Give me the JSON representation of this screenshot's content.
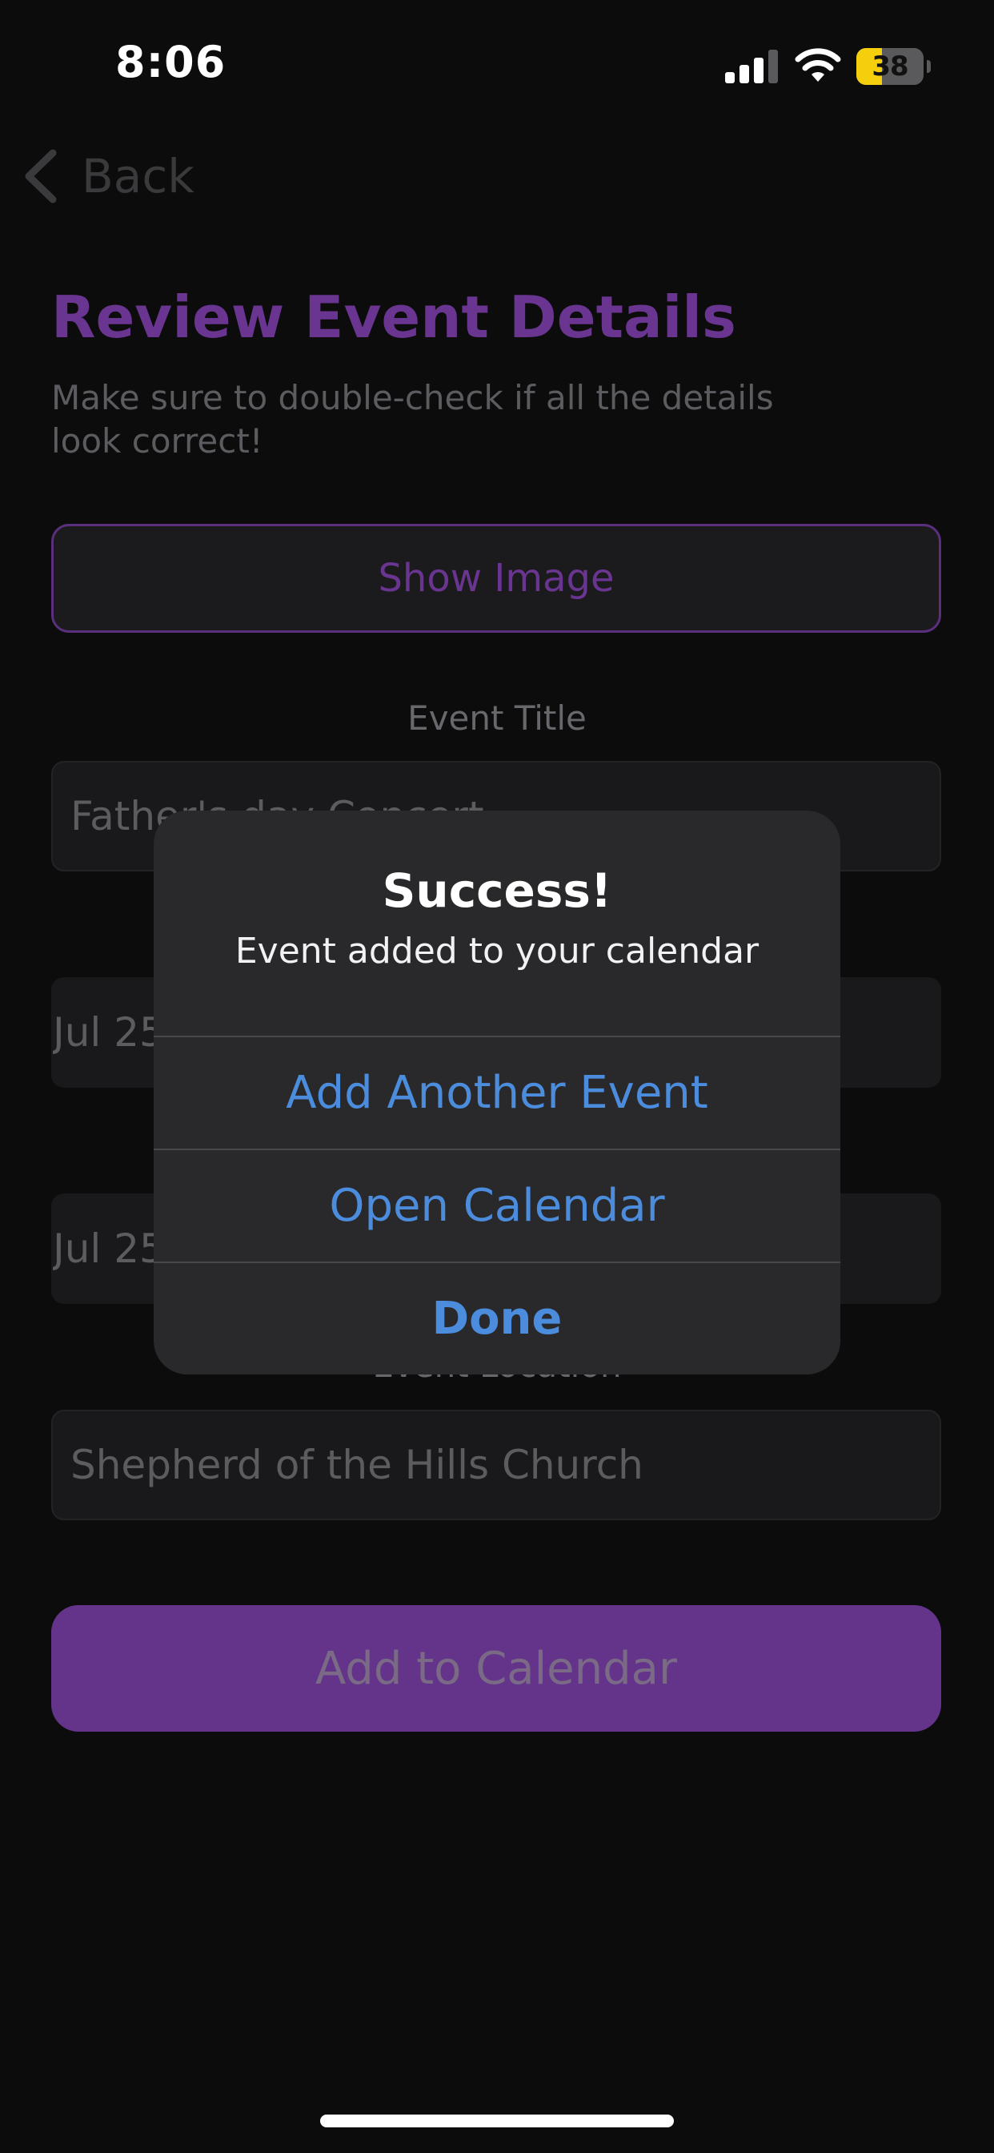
{
  "status_bar": {
    "time": "8:06",
    "battery_percent": 38,
    "battery_charging": true,
    "signal_bars": 3,
    "signal_bars_total": 4,
    "icons": [
      "signal-icon",
      "wifi-icon",
      "battery-icon"
    ]
  },
  "nav": {
    "back_label": "Back",
    "back_icon": "chevron-left-icon"
  },
  "page": {
    "title": "Review Event Details",
    "subtitle": "Make sure to double-check if all the details look correct!",
    "show_image_label": "Show Image",
    "event_title_label": "Event Title",
    "event_title_value": "Father's day Concert",
    "start_value": "Jul 25",
    "end_value": "Jul 25",
    "location_label": "Event Location",
    "location_value": "Shepherd of the Hills Church",
    "add_button_label": "Add to Calendar"
  },
  "alert": {
    "title": "Success!",
    "message": "Event added to your calendar",
    "actions": [
      {
        "label": "Add Another Event"
      },
      {
        "label": "Open Calendar"
      },
      {
        "label": "Done"
      }
    ]
  },
  "colors": {
    "background": "#0c0c0d",
    "accent_purple": "#6a3590",
    "button_purple": "#64348a",
    "alert_background": "#29292b",
    "action_blue": "#4b8cdd",
    "battery_yellow": "#f5cf0d"
  }
}
